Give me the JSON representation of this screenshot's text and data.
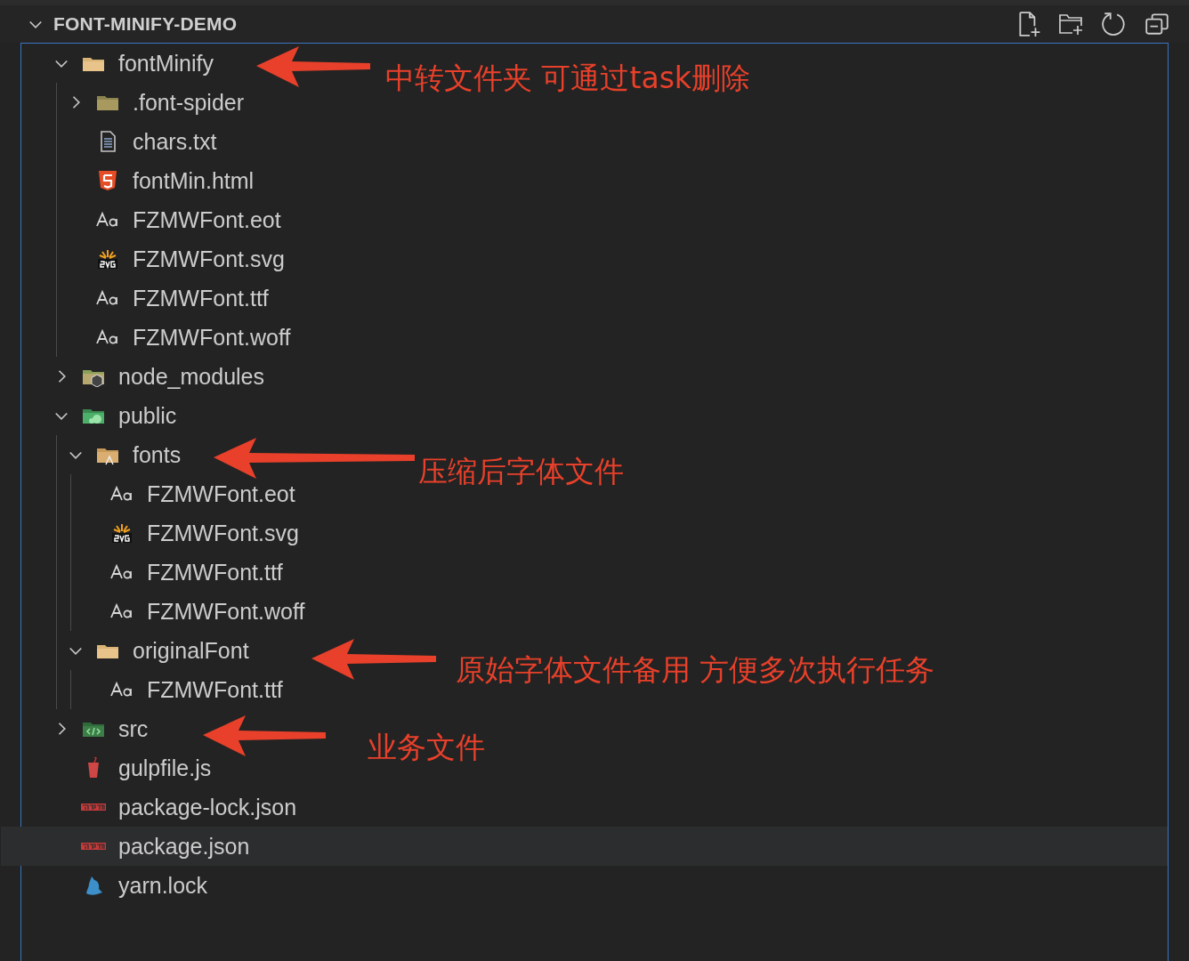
{
  "explorer": {
    "title": "FONT-MINIFY-DEMO",
    "expanded": true
  },
  "tree": [
    {
      "name": "fontMinify",
      "kind": "folder",
      "expanded": true,
      "hovered": false,
      "children": [
        {
          "name": ".font-spider",
          "kind": "dot-folder",
          "expanded": false,
          "hovered": false
        },
        {
          "name": "chars.txt",
          "kind": "text",
          "hovered": false
        },
        {
          "name": "fontMin.html",
          "kind": "html",
          "hovered": false
        },
        {
          "name": "FZMWFont.eot",
          "kind": "font",
          "hovered": false
        },
        {
          "name": "FZMWFont.svg",
          "kind": "svg",
          "hovered": false
        },
        {
          "name": "FZMWFont.ttf",
          "kind": "font",
          "hovered": false
        },
        {
          "name": "FZMWFont.woff",
          "kind": "font",
          "hovered": false
        }
      ]
    },
    {
      "name": "node_modules",
      "kind": "node-folder",
      "expanded": false,
      "hovered": false
    },
    {
      "name": "public",
      "kind": "public-folder",
      "expanded": true,
      "hovered": false,
      "children": [
        {
          "name": "fonts",
          "kind": "fonts-folder",
          "expanded": true,
          "hovered": false,
          "children": [
            {
              "name": "FZMWFont.eot",
              "kind": "font",
              "hovered": false
            },
            {
              "name": "FZMWFont.svg",
              "kind": "svg",
              "hovered": false
            },
            {
              "name": "FZMWFont.ttf",
              "kind": "font",
              "hovered": false
            },
            {
              "name": "FZMWFont.woff",
              "kind": "font",
              "hovered": false
            }
          ]
        },
        {
          "name": "originalFont",
          "kind": "folder",
          "expanded": true,
          "hovered": false,
          "children": [
            {
              "name": "FZMWFont.ttf",
              "kind": "font",
              "hovered": false
            }
          ]
        }
      ]
    },
    {
      "name": "src",
      "kind": "src-folder",
      "expanded": false,
      "hovered": false
    },
    {
      "name": "gulpfile.js",
      "kind": "gulp",
      "hovered": false
    },
    {
      "name": "package-lock.json",
      "kind": "npm",
      "hovered": false
    },
    {
      "name": "package.json",
      "kind": "npm",
      "hovered": true
    },
    {
      "name": "yarn.lock",
      "kind": "yarn",
      "hovered": false
    }
  ],
  "annotations": [
    {
      "text": "中转文件夹 可通过task删除"
    },
    {
      "text": "压缩后字体文件"
    },
    {
      "text": "原始字体文件备用 方便多次执行任务"
    },
    {
      "text": "业务文件"
    }
  ]
}
